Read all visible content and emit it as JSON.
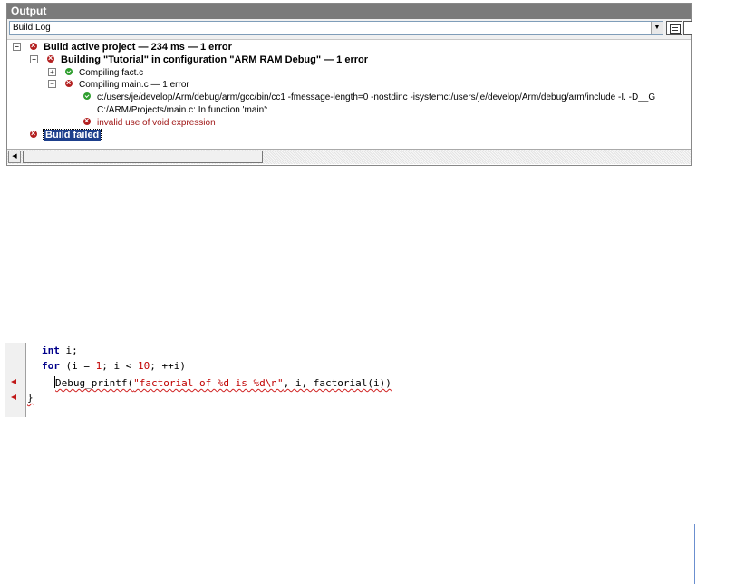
{
  "output": {
    "title": "Output",
    "log_selector": {
      "selected": "Build Log"
    },
    "tree": [
      {
        "text": "Build active project — 234 ms — 1 error",
        "status": "error",
        "expander": "−"
      },
      {
        "text": "Building \"Tutorial\" in configuration \"ARM RAM Debug\" — 1 error",
        "status": "error",
        "expander": "−"
      },
      {
        "text": "Compiling fact.c",
        "status": "ok",
        "expander": "+"
      },
      {
        "text": "Compiling main.c — 1 error",
        "status": "error",
        "expander": "−"
      },
      {
        "text": "c:/users/je/develop/Arm/debug/arm/gcc/bin/cc1 -fmessage-length=0 -nostdinc -isystemc:/users/je/develop/Arm/debug/arm/include -I. -D__G",
        "status": "ok"
      },
      {
        "text": "C:/ARM/Projects/main.c: In function 'main':"
      },
      {
        "text": "invalid use of void expression",
        "status": "error"
      },
      {
        "text": "Build failed",
        "status": "error"
      }
    ]
  },
  "editor": {
    "lines": [
      {
        "keyword": "int",
        "rest": " i;"
      },
      {
        "keyword": "for",
        "p1": " (i = ",
        "n1": "1",
        "p2": "; i < ",
        "n2": "10",
        "p3": "; ++i)"
      },
      {
        "func": "Debug_printf(",
        "str": "\"factorial of %d is %d\\n\"",
        "tail": ", i, factorial(i))"
      },
      {
        "text": "}"
      }
    ]
  }
}
